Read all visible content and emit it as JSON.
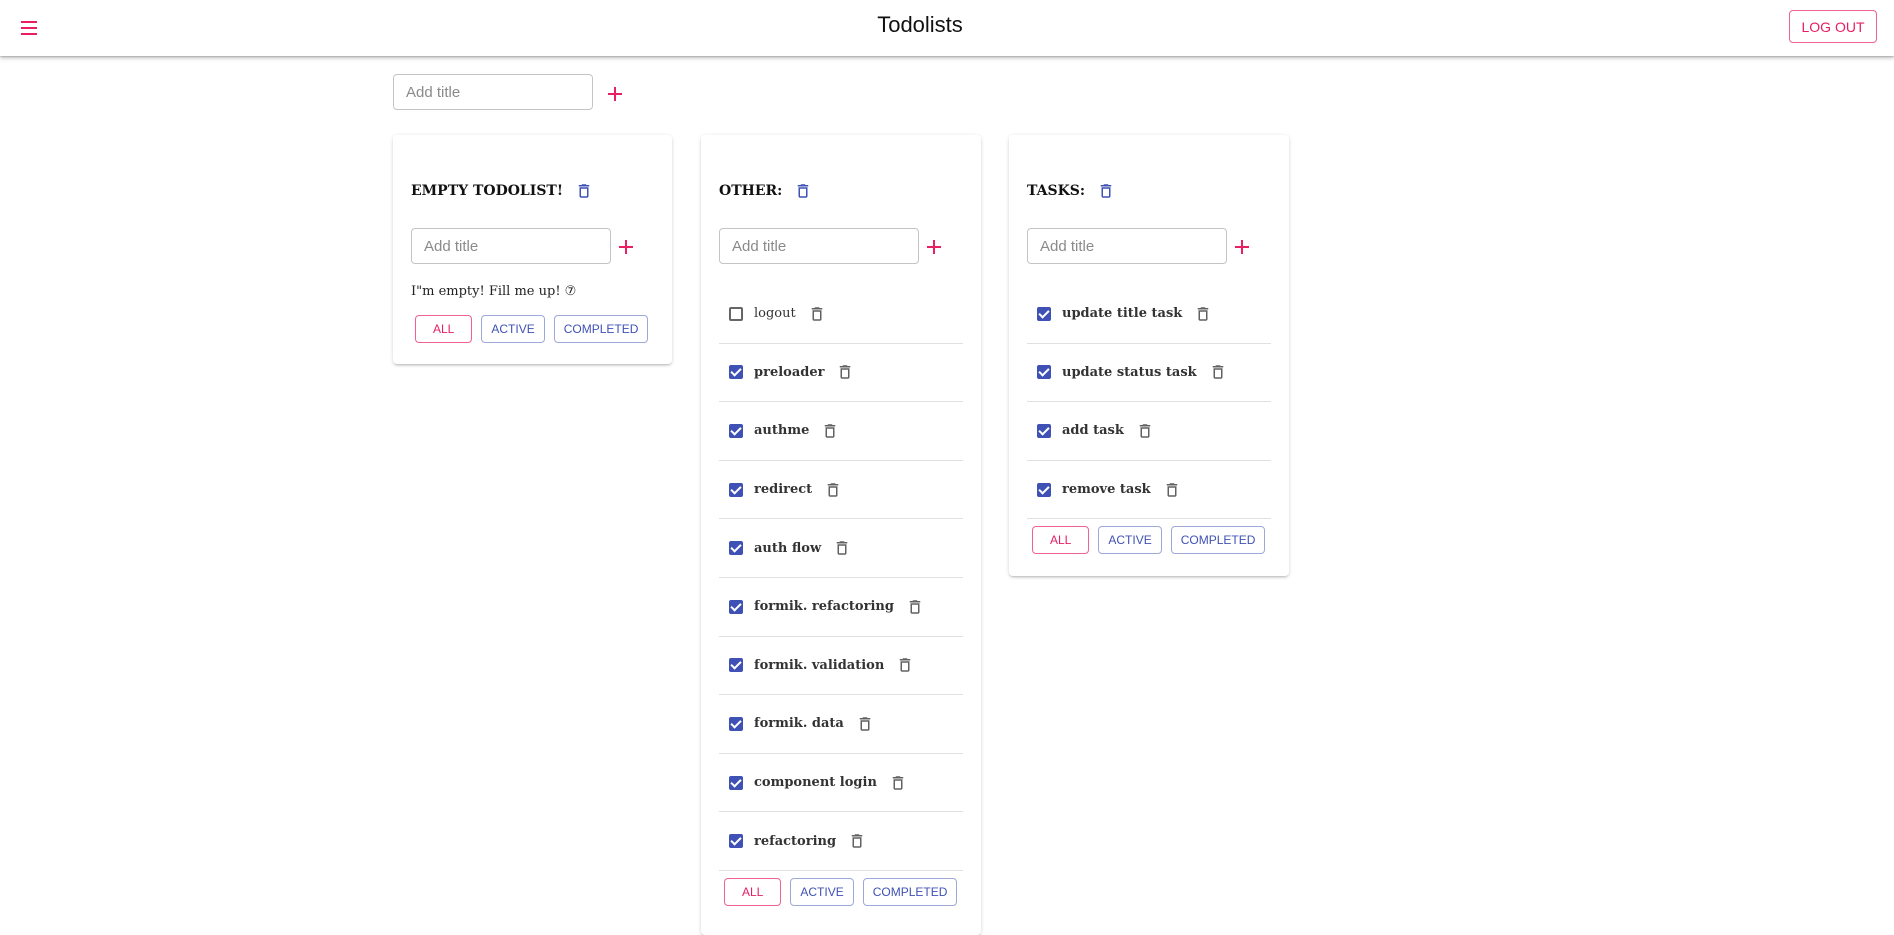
{
  "app": {
    "title": "Todolists",
    "logout_label": "LOG OUT"
  },
  "new_todolist": {
    "placeholder": "Add title"
  },
  "colors": {
    "accent": "#e91e63",
    "primary": "#3f51b5"
  },
  "filters": {
    "all": "ALL",
    "active": "ACTIVE",
    "completed": "COMPLETED"
  },
  "todolists": [
    {
      "title": "EMPTY TODOLIST!",
      "add_placeholder": "Add title",
      "empty_message": "I\"m empty! Fill me up! ⑦",
      "tasks": []
    },
    {
      "title": "OTHER:",
      "add_placeholder": "Add title",
      "tasks": [
        {
          "title": "logout",
          "done": false
        },
        {
          "title": "preloader",
          "done": true
        },
        {
          "title": "authme",
          "done": true
        },
        {
          "title": "redirect",
          "done": true
        },
        {
          "title": "auth flow",
          "done": true
        },
        {
          "title": "formik. refactoring",
          "done": true
        },
        {
          "title": "formik. validation",
          "done": true
        },
        {
          "title": "formik. data",
          "done": true
        },
        {
          "title": "component login",
          "done": true
        },
        {
          "title": "refactoring",
          "done": true
        }
      ]
    },
    {
      "title": "TASKS:",
      "add_placeholder": "Add title",
      "tasks": [
        {
          "title": "update title task",
          "done": true
        },
        {
          "title": "update status task",
          "done": true
        },
        {
          "title": "add task",
          "done": true
        },
        {
          "title": "remove task",
          "done": true
        }
      ]
    }
  ]
}
